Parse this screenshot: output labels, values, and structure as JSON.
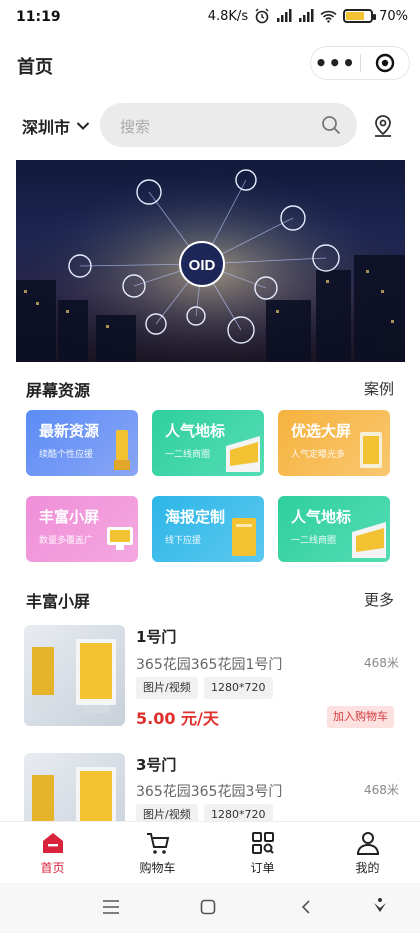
{
  "status": {
    "time": "11:19",
    "speed": "4.8K/s",
    "battery": "70",
    "battery_level": 0.7
  },
  "header": {
    "title": "首页"
  },
  "search": {
    "city": "深圳市",
    "placeholder": "搜索"
  },
  "banner": {
    "label": "OID"
  },
  "section1": {
    "title": "屏幕资源",
    "more": "案例",
    "cards": [
      {
        "title": "最新资源",
        "sub": "续酷个性应援"
      },
      {
        "title": "人气地标",
        "sub": "一二线商圈"
      },
      {
        "title": "优选大屏",
        "sub": "人气定曝光多"
      },
      {
        "title": "丰富小屏",
        "sub": "数量多覆盖广"
      },
      {
        "title": "海报定制",
        "sub": "线下应援"
      },
      {
        "title": "人气地标",
        "sub": "一二线商圈"
      }
    ]
  },
  "section2": {
    "title": "丰富小屏",
    "more": "更多",
    "items": [
      {
        "name": "1号门",
        "addr": "365花园365花园1号门",
        "dist": "468米",
        "tag1": "图片/视频",
        "tag2": "1280*720",
        "price": "5.00 元/天",
        "cart": "加入购物车"
      },
      {
        "name": "3号门",
        "addr": "365花园365花园3号门",
        "dist": "468米",
        "tag1": "图片/视频",
        "tag2": "1280*720"
      }
    ]
  },
  "tabs": [
    {
      "label": "首页",
      "icon": "home-icon"
    },
    {
      "label": "购物车",
      "icon": "cart-icon"
    },
    {
      "label": "订单",
      "icon": "orders-icon"
    },
    {
      "label": "我的",
      "icon": "profile-icon"
    }
  ],
  "colors": {
    "accent": "#d9233a",
    "price": "#e0302c"
  }
}
